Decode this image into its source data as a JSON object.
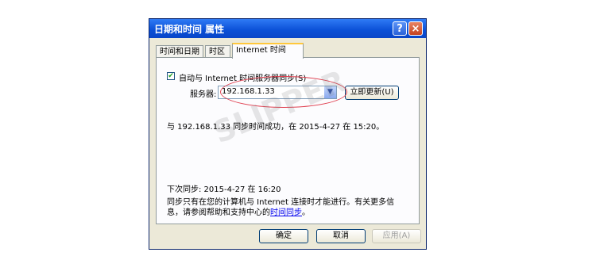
{
  "window": {
    "title": "日期和时间 属性",
    "help_button": "?",
    "close_button": "×"
  },
  "tabs": [
    {
      "label": "时间和日期",
      "active": false
    },
    {
      "label": "时区",
      "active": false
    },
    {
      "label": "Internet 时间",
      "active": true
    }
  ],
  "internet_time": {
    "sync_checked": true,
    "sync_label": "自动与 Internet 时间服务器同步(S)",
    "server_label": "服务器:",
    "server_value": "192.168.1.33",
    "update_button": "立即更新(U)",
    "status_text": "与 192.168.1.33 同步时间成功，在 2015-4-27 在 15:20。",
    "next_sync_text": "下次同步: 2015-4-27 在 16:20",
    "info_line1": "同步只有在您的计算机与 Internet 连接时才能进行。有关更多信",
    "info_line2_prefix": "息，请参阅帮助和支持中心的",
    "info_link": "时间同步",
    "info_line2_suffix": "。"
  },
  "watermark": "SLIPPER",
  "footer": {
    "ok_button": "确定",
    "cancel_button": "取消",
    "apply_button": "应用(A)"
  },
  "colors": {
    "titlebar": "#0a4fd6",
    "dialog_bg": "#ece9d8",
    "annotation_ellipse": "#e04050",
    "link": "#0000ee"
  }
}
